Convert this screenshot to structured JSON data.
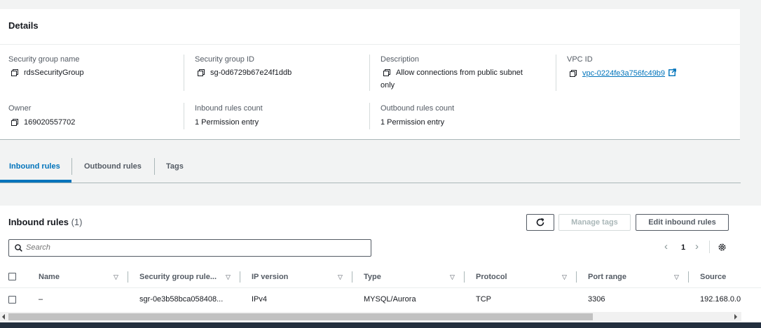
{
  "details": {
    "title": "Details",
    "fields": {
      "sg_name_label": "Security group name",
      "sg_name_value": "rdsSecurityGroup",
      "sg_id_label": "Security group ID",
      "sg_id_value": "sg-0d6729b67e24f1ddb",
      "description_label": "Description",
      "description_line1": "Allow connections from public subnet",
      "description_line2": "only",
      "vpc_label": "VPC ID",
      "vpc_value": "vpc-0224fe3a756fc49b9",
      "owner_label": "Owner",
      "owner_value": "169020557702",
      "inbound_count_label": "Inbound rules count",
      "inbound_count_value": "1 Permission entry",
      "outbound_count_label": "Outbound rules count",
      "outbound_count_value": "1 Permission entry"
    }
  },
  "tabs": [
    {
      "label": "Inbound rules",
      "active": true
    },
    {
      "label": "Outbound rules",
      "active": false
    },
    {
      "label": "Tags",
      "active": false
    }
  ],
  "rules": {
    "title": "Inbound rules",
    "count": "(1)",
    "manage_tags_label": "Manage tags",
    "edit_label": "Edit inbound rules",
    "search_placeholder": "Search",
    "page": "1",
    "columns": [
      "Name",
      "Security group rule...",
      "IP version",
      "Type",
      "Protocol",
      "Port range",
      "Source"
    ],
    "rows": [
      {
        "name": "–",
        "rule_id": "sgr-0e3b58bca058408...",
        "ip_version": "IPv4",
        "type": "MYSQL/Aurora",
        "protocol": "TCP",
        "port_range": "3306",
        "source": "192.168.0.0"
      }
    ]
  },
  "colors": {
    "link": "#0073bb",
    "active_tab": "#0073bb",
    "background": "#f2f3f3"
  },
  "icons": [
    "copy-icon",
    "external-link-icon",
    "refresh-icon",
    "search-icon",
    "chevron-left-icon",
    "chevron-right-icon",
    "gear-icon",
    "sort-icon"
  ]
}
